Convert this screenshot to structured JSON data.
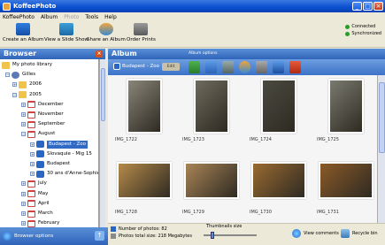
{
  "window": {
    "title": "KoffeePhoto"
  },
  "menu": [
    "KoffeePhoto",
    "Album",
    "Photo",
    "Tools",
    "Help"
  ],
  "menu_disabled_index": 2,
  "toolbar": {
    "create_album": "Create an Album",
    "slide_show": "View a Slide Show",
    "share_album": "Share an Album",
    "order_prints": "Order Prints"
  },
  "status": {
    "connected": "Connected",
    "synchronized": "Synchronized"
  },
  "browser": {
    "title": "Browser",
    "footer_label": "Browser options",
    "nodes": [
      {
        "label": "My photo library",
        "type": "folder"
      },
      {
        "label": "Gilles",
        "type": "user"
      },
      {
        "label": "2006",
        "type": "folder"
      },
      {
        "label": "2005",
        "type": "folder"
      },
      {
        "label": "December",
        "type": "cal"
      },
      {
        "label": "November",
        "type": "cal"
      },
      {
        "label": "September",
        "type": "cal"
      },
      {
        "label": "August",
        "type": "cal"
      },
      {
        "label": "Budapest - Zoo",
        "type": "album"
      },
      {
        "label": "Slovaquie - Mig 15",
        "type": "album"
      },
      {
        "label": "Budapest",
        "type": "album"
      },
      {
        "label": "30 ans d'Anne-Sophie",
        "type": "album"
      },
      {
        "label": "July",
        "type": "cal"
      },
      {
        "label": "May",
        "type": "cal"
      },
      {
        "label": "April",
        "type": "cal"
      },
      {
        "label": "March",
        "type": "cal"
      },
      {
        "label": "February",
        "type": "cal"
      }
    ]
  },
  "album": {
    "title": "Album",
    "options_label": "Album options",
    "name": "Budapest - Zoo",
    "edit_label": "Edit",
    "photos": [
      {
        "caption": "IMG_1722",
        "color": "#8a8578"
      },
      {
        "caption": "IMG_1723",
        "color": "#6e6a5c"
      },
      {
        "caption": "IMG_1724",
        "color": "#4a4a40"
      },
      {
        "caption": "IMG_1725",
        "color": "#7a7a70"
      },
      {
        "caption": "IMG_1728",
        "color": "#b58a4a"
      },
      {
        "caption": "IMG_1729",
        "color": "#a98456"
      },
      {
        "caption": "IMG_1730",
        "color": "#9a6a32"
      },
      {
        "caption": "IMG_1731",
        "color": "#8b5a28"
      }
    ],
    "num_photos_label": "Number of photos: 82",
    "total_size_label": "Photos total size: 218 Megabytes",
    "thumb_size_label": "Thumbnails size",
    "view_comments": "View comments",
    "recycle_bin": "Recycle bin"
  },
  "colors": {
    "accent": "#316ac5",
    "header": "#2f64b9"
  }
}
